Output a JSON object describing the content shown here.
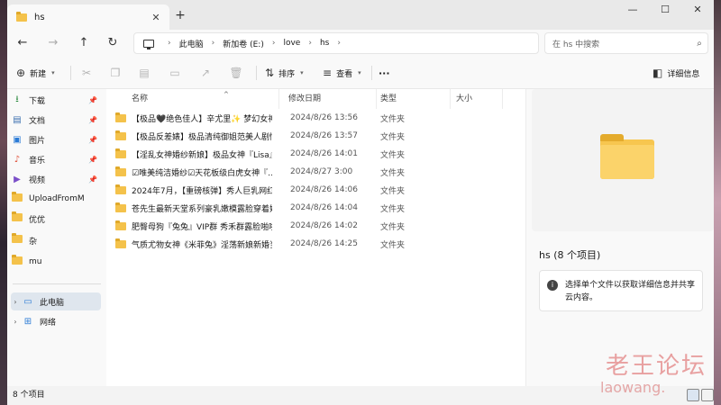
{
  "tab": {
    "title": "hs"
  },
  "window_controls": {
    "minimize": "—",
    "maximize": "☐",
    "close": "✕"
  },
  "nav": {
    "back": "←",
    "forward": "→",
    "up": "↑",
    "refresh": "↻"
  },
  "breadcrumb": [
    "此电脑",
    "新加卷 (E:)",
    "love",
    "hs"
  ],
  "search": {
    "placeholder": "在 hs 中搜索"
  },
  "toolbar": {
    "new_label": "新建",
    "sort_label": "排序",
    "view_label": "查看",
    "more_label": "···",
    "details_label": "详细信息"
  },
  "sidebar": {
    "quick": [
      {
        "label": "下载",
        "icon": "download-icon",
        "pinned": true
      },
      {
        "label": "文档",
        "icon": "document-icon",
        "pinned": true
      },
      {
        "label": "图片",
        "icon": "picture-icon",
        "pinned": true
      },
      {
        "label": "音乐",
        "icon": "music-icon",
        "pinned": true
      },
      {
        "label": "视频",
        "icon": "video-icon",
        "pinned": true
      },
      {
        "label": "UploadFromM",
        "icon": "folder-icon",
        "pinned": false
      },
      {
        "label": "优优",
        "icon": "folder-icon",
        "pinned": false
      },
      {
        "label": "杂",
        "icon": "folder-icon",
        "pinned": false
      },
      {
        "label": "mu",
        "icon": "folder-icon",
        "pinned": false
      }
    ],
    "this_pc": "此电脑",
    "network": "网络"
  },
  "columns": {
    "name": "名称",
    "modified": "修改日期",
    "type": "类型",
    "size": "大小"
  },
  "files": [
    {
      "name": "【极品🖤绝色佳人】辛尤里✨ 梦幻女神…",
      "modified": "2024/8/26 13:56",
      "type": "文件夹"
    },
    {
      "name": "【极品反差婊】极品清纯御姐范美人剧情…",
      "modified": "2024/8/26 13:57",
      "type": "文件夹"
    },
    {
      "name": "【淫乱女神婚纱新娘】极品女神『Lisa』…",
      "modified": "2024/8/26 14:01",
      "type": "文件夹"
    },
    {
      "name": "☑唯美纯洁婚纱☑天花板级白虎女神『…",
      "modified": "2024/8/27 3:00",
      "type": "文件夹"
    },
    {
      "name": "2024年7月，【重磅核弹】秀人巨乳网红…",
      "modified": "2024/8/26 14:06",
      "type": "文件夹"
    },
    {
      "name": "苍先生最新天堂系列豪乳嫩模露脸穿着婚…",
      "modified": "2024/8/26 14:04",
      "type": "文件夹"
    },
    {
      "name": "肥臀母狗『兔兔』VIP群 秀禾群露脸啪啪…",
      "modified": "2024/8/26 14:02",
      "type": "文件夹"
    },
    {
      "name": "气质尤物女神《米菲兔》淫荡新娘新婚当…",
      "modified": "2024/8/26 14:25",
      "type": "文件夹"
    }
  ],
  "details": {
    "title": "hs (8 个项目)",
    "info": "选择单个文件以获取详细信息并共享云内容。"
  },
  "status": {
    "count": "8 个项目"
  },
  "watermark": {
    "site_cn": "老王论坛",
    "site_url": "laowang."
  }
}
